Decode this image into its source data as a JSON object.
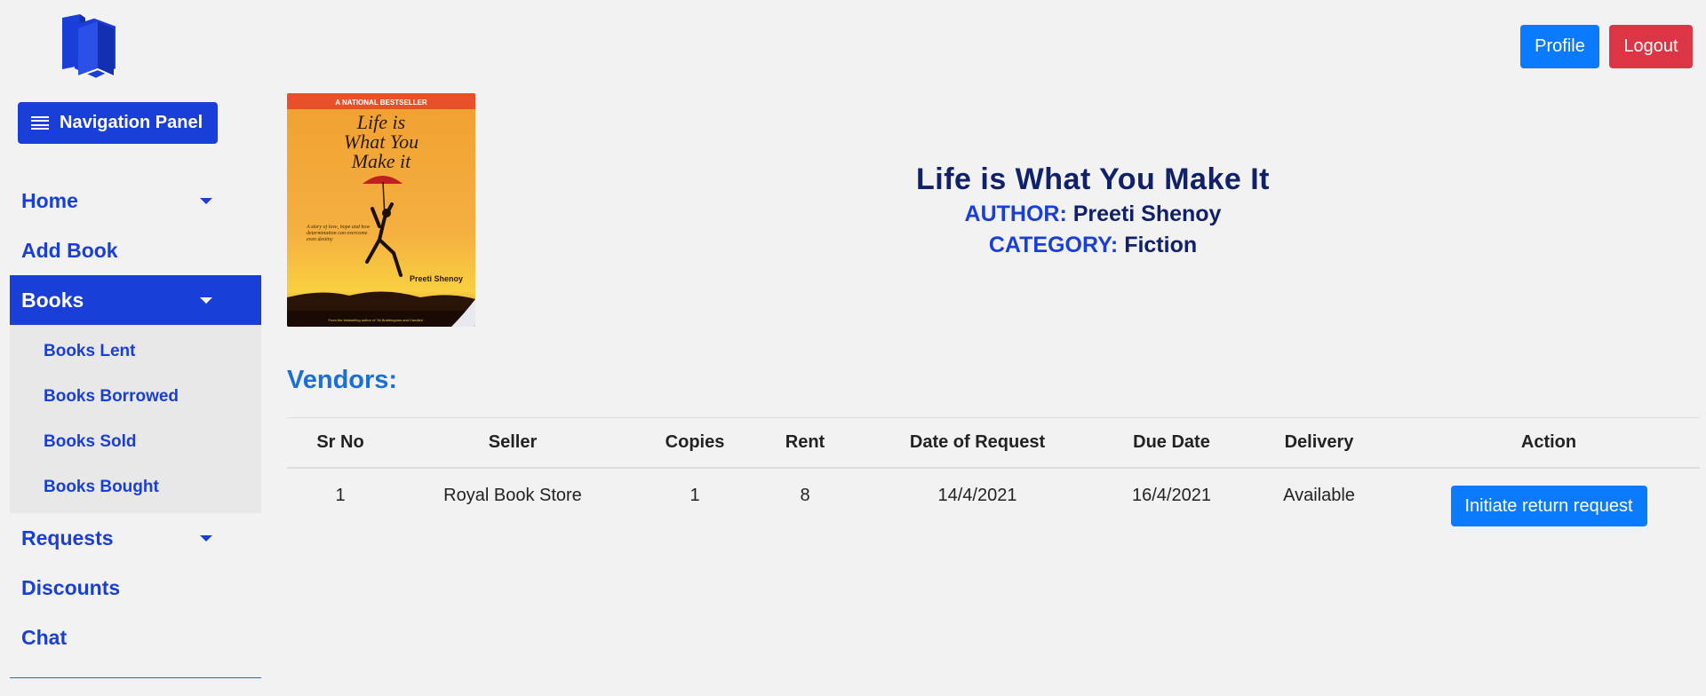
{
  "header": {
    "profile_label": "Profile",
    "logout_label": "Logout"
  },
  "sidebar": {
    "nav_panel_label": "Navigation Panel",
    "items": [
      {
        "label": "Home",
        "has_caret": true
      },
      {
        "label": "Add Book",
        "has_caret": false
      },
      {
        "label": "Books",
        "has_caret": true,
        "active": true,
        "subitems": [
          "Books Lent",
          "Books Borrowed",
          "Books Sold",
          "Books Bought"
        ]
      },
      {
        "label": "Requests",
        "has_caret": true
      },
      {
        "label": "Discounts",
        "has_caret": false
      },
      {
        "label": "Chat",
        "has_caret": false
      }
    ]
  },
  "book": {
    "title": "Life is What You Make It",
    "author_label": "AUTHOR:",
    "author": "Preeti Shenoy",
    "category_label": "CATEGORY:",
    "category": "Fiction",
    "cover": {
      "top_banner": "A NATIONAL BESTSELLER",
      "title_lines": [
        "Life is",
        "What You",
        "Make it"
      ],
      "tagline": "A story of love, hope and how determination can overcome even destiny",
      "author": "Preeti Shenoy",
      "footer": "From the bestselling author of '34 Bubblegums and Candies'"
    }
  },
  "vendors": {
    "heading": "Vendors:",
    "columns": [
      "Sr No",
      "Seller",
      "Copies",
      "Rent",
      "Date of Request",
      "Due Date",
      "Delivery",
      "Action"
    ],
    "rows": [
      {
        "sr": "1",
        "seller": "Royal Book Store",
        "copies": "1",
        "rent": "8",
        "date_of_request": "14/4/2021",
        "due_date": "16/4/2021",
        "delivery": "Available",
        "action_label": "Initiate return request"
      }
    ]
  },
  "colors": {
    "primary": "#1a3fd8",
    "button_blue": "#0a7bff",
    "danger": "#dc3545",
    "title_navy": "#10206a"
  }
}
